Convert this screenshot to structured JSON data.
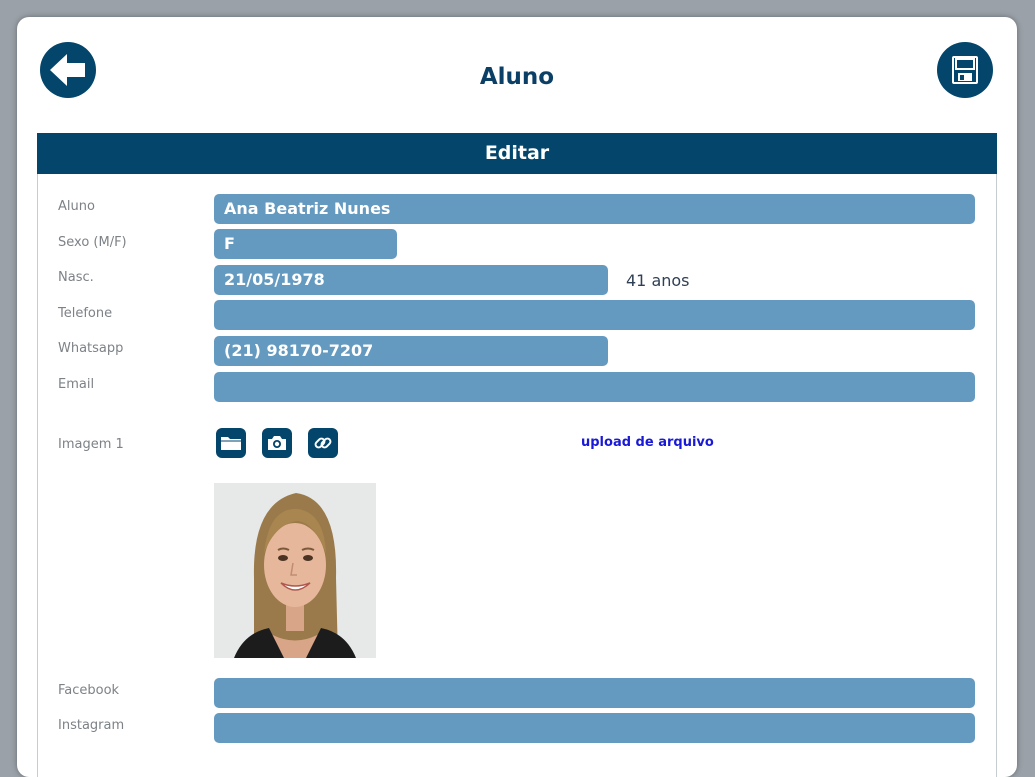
{
  "header": {
    "title": "Aluno",
    "back_icon": "arrow-left-icon",
    "save_icon": "floppy-disk-icon"
  },
  "section": {
    "title": "Editar"
  },
  "form": {
    "aluno": {
      "label": "Aluno",
      "value": "Ana Beatriz Nunes"
    },
    "sexo": {
      "label": "Sexo (M/F)",
      "value": "F"
    },
    "nasc": {
      "label": "Nasc.",
      "value": "21/05/1978",
      "age": "41 anos"
    },
    "telefone": {
      "label": "Telefone",
      "value": ""
    },
    "whatsapp": {
      "label": "Whatsapp",
      "value": "(21) 98170-7207"
    },
    "email": {
      "label": "Email",
      "value": ""
    },
    "imagem": {
      "label": "Imagem 1",
      "icons": [
        "folder-icon",
        "camera-icon",
        "link-icon"
      ],
      "upload_text": "upload de arquivo"
    },
    "facebook": {
      "label": "Facebook",
      "value": ""
    },
    "instagram": {
      "label": "Instagram",
      "value": ""
    }
  },
  "colors": {
    "primary": "#03456b",
    "input_bg": "#6499c0",
    "link": "#1a1ad6"
  }
}
